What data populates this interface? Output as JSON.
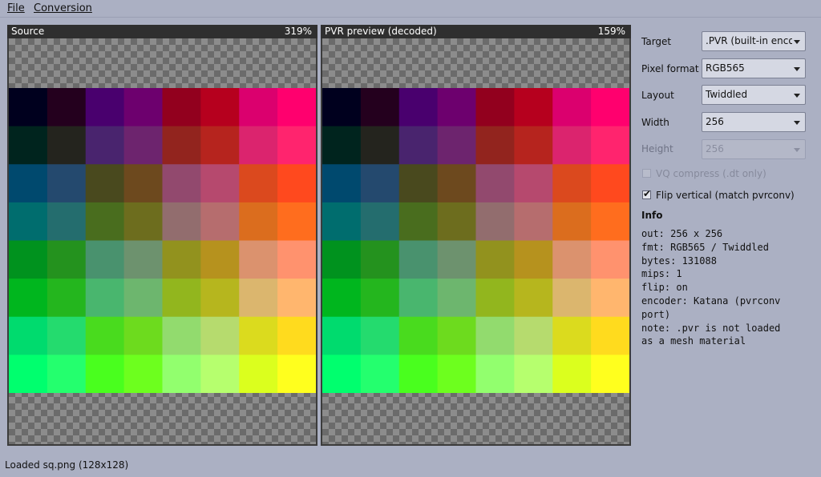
{
  "menu": {
    "file": "File",
    "conversion": "Conversion"
  },
  "source_panel": {
    "title": "Source",
    "zoom": "319%"
  },
  "preview_panel": {
    "title": "PVR preview (decoded)",
    "zoom": "159%"
  },
  "properties": {
    "target": {
      "label": "Target",
      "value": ".PVR (built-in encoc"
    },
    "pixel_format": {
      "label": "Pixel format",
      "value": "RGB565"
    },
    "layout": {
      "label": "Layout",
      "value": "Twiddled"
    },
    "width": {
      "label": "Width",
      "value": "256"
    },
    "height": {
      "label": "Height",
      "value": "256"
    },
    "vq_compress": {
      "label": "VQ compress (.dt only)",
      "checked": false
    },
    "flip_vertical": {
      "label": "Flip vertical (match pvrconv)",
      "checked": true
    }
  },
  "info": {
    "title": "Info",
    "lines": [
      "out: 256 x 256",
      "fmt: RGB565 / Twiddled",
      "bytes: 131088",
      "mips: 1",
      "flip: on",
      "encoder: Katana (pvrconv port)",
      "note: .pvr is not loaded as a mesh material"
    ]
  },
  "status": "Loaded sq.png (128x128)"
}
